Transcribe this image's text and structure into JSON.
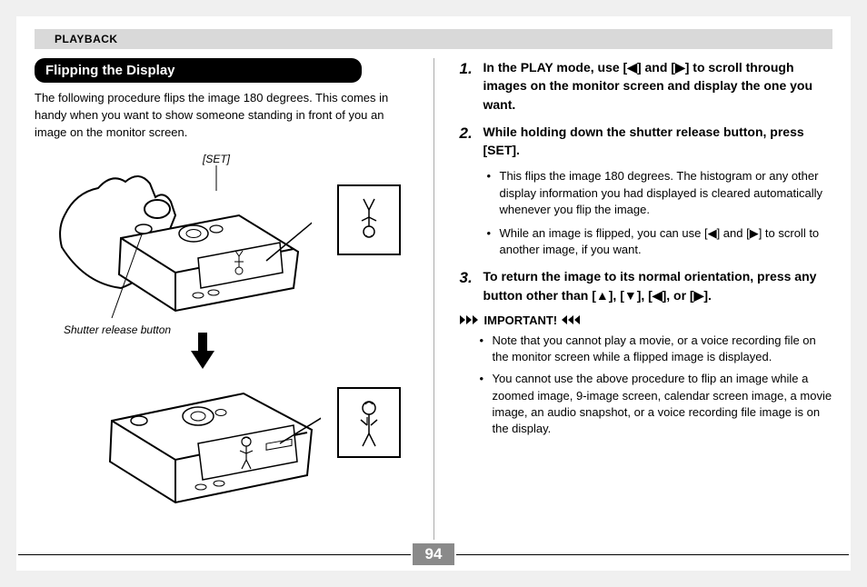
{
  "header": "PLAYBACK",
  "section_title": "Flipping the Display",
  "intro": "The following procedure flips the image 180 degrees. This comes in handy when you want to show someone standing in front of you an image on the monitor screen.",
  "caption_set": "[SET]",
  "caption_shutter": "Shutter release button",
  "steps": {
    "s1_num": "1.",
    "s1_text": "In the PLAY mode, use [◀] and [▶] to scroll through images on the monitor screen and display the one you want.",
    "s2_num": "2.",
    "s2_text": "While holding down the shutter release button, press [SET].",
    "s2_b1": "This flips the image 180 degrees. The histogram or any other display information you had displayed is cleared automatically whenever you flip the image.",
    "s2_b2": "While an image is flipped, you can use [◀] and [▶] to scroll to another image, if you want.",
    "s3_num": "3.",
    "s3_text": "To return the image to its normal orientation, press any button other than [▲], [▼], [◀], or [▶]."
  },
  "important_label": "IMPORTANT!",
  "important": {
    "b1": "Note that you cannot play a movie, or a voice recording file on the monitor screen while a flipped image is displayed.",
    "b2": "You cannot use the above procedure to flip an image while a zoomed image, 9-image screen, calendar screen image, a movie image, an audio snapshot, or a voice recording file image is on the display."
  },
  "page_number": "94"
}
